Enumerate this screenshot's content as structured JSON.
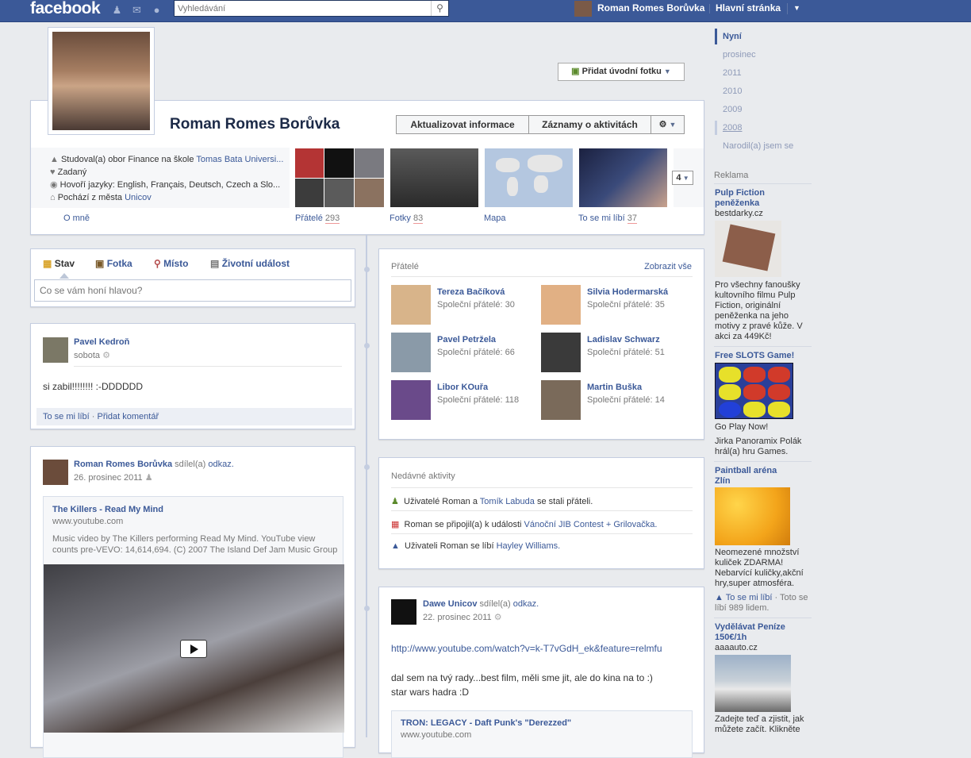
{
  "topbar": {
    "logo": "facebook",
    "search_placeholder": "Vyhledávání",
    "user_name": "Roman Romes Borůvka",
    "home": "Hlavní stránka"
  },
  "cover": {
    "add_cover_label": "Přidat úvodní fotku",
    "name": "Roman Romes Borůvka",
    "update_info": "Aktualizovat informace",
    "activity_log": "Záznamy o aktivitách",
    "about": [
      {
        "prefix": "Studoval(a) obor Finance na škole ",
        "link": "Tomas Bata Universi..."
      },
      {
        "prefix": "Zadaný",
        "link": ""
      },
      {
        "prefix": "Hovoří jazyky: English, Français, Deutsch, Czech a Slo...",
        "link": ""
      },
      {
        "prefix": "Pochází z města ",
        "link": "Unicov"
      }
    ],
    "about_link": "O mně",
    "tiles": [
      {
        "label": "Přátelé",
        "count": "293"
      },
      {
        "label": "Fotky",
        "count": "83"
      },
      {
        "label": "Mapa",
        "count": ""
      },
      {
        "label": "To se mi líbí",
        "count": "37"
      }
    ],
    "more_count": "4"
  },
  "composer": {
    "tabs": [
      "Stav",
      "Fotka",
      "Místo",
      "Životní událost"
    ],
    "placeholder": "Co se vám honí hlavou?"
  },
  "post1": {
    "author": "Pavel Kedroň",
    "time": "sobota",
    "text": "si zabil!!!!!!!! :-DDDDDD",
    "like": "To se mi líbí",
    "dot": "·",
    "comment": "Přidat komentář"
  },
  "post2": {
    "author": "Roman Romes Borůvka",
    "shared": " sdílel(a) ",
    "shared_link": "odkaz.",
    "time": "26. prosinec 2011",
    "link_title": "The Killers - Read My Mind",
    "link_domain": "www.youtube.com",
    "link_desc": "Music video by The Killers performing Read My Mind. YouTube view counts pre-VEVO: 14,614,694. (C) 2007 The Island Def Jam Music Group"
  },
  "friends": {
    "title": "Přátelé",
    "show_all": "Zobrazit vše",
    "list": [
      {
        "name": "Tereza Bačíková",
        "mutual": "Společní přátelé: 30"
      },
      {
        "name": "Silvia Hodermarská",
        "mutual": "Společní přátelé: 35"
      },
      {
        "name": "Pavel Petržela",
        "mutual": "Společní přátelé: 66"
      },
      {
        "name": "Ladislav Schwarz",
        "mutual": "Společní přátelé: 51"
      },
      {
        "name": "Libor KOuřa",
        "mutual": "Společní přátelé: 118"
      },
      {
        "name": "Martin Buška",
        "mutual": "Společní přátelé: 14"
      }
    ]
  },
  "recent": {
    "title": "Nedávné aktivity",
    "items": [
      {
        "a": "Uživatelé Roman a ",
        "link": "Tomík Labuda",
        "b": " se stali přáteli."
      },
      {
        "a": "Roman se připojil(a) k události ",
        "link": "Vánoční JIB Contest + Grilovačka.",
        "b": ""
      },
      {
        "a": "Uživateli Roman se líbí ",
        "link": "Hayley Williams.",
        "b": ""
      }
    ]
  },
  "post3": {
    "author": "Dawe Unicov",
    "shared": " sdílel(a) ",
    "shared_link": "odkaz.",
    "time": "22. prosinec 2011",
    "url": "http://www.youtube.com/watch?v=k-T7vGdH_ek&feature=relmfu",
    "text1": "dal sem na tvý rady...best film, měli sme jit, ale do kina na to :)",
    "text2": "star wars hadra :D",
    "link_title": "TRON: LEGACY - Daft Punk's \"Derezzed\"",
    "link_domain": "www.youtube.com"
  },
  "timeline": [
    "Nyní",
    "prosinec",
    "2011",
    "2010",
    "2009",
    "2008",
    "Narodil(a) jsem se"
  ],
  "ads": {
    "header": "Reklama",
    "items": [
      {
        "title1": "Pulp Fiction",
        "title2": "peněženka",
        "domain": "bestdarky.cz",
        "text": [
          "Pro všechny fanoušky",
          "kultovního filmu Pulp",
          "Fiction, originální",
          "peněženka na jeho",
          "motivy z pravé kůže. V",
          "akci za 449Kč!"
        ]
      },
      {
        "title1": "Free SLOTS Game!",
        "title2": "",
        "domain": "",
        "text": [
          "Go Play Now!"
        ],
        "social": [
          "Jirka Panoramix Polák",
          "hrál(a) hru Games."
        ]
      },
      {
        "title1": "Paintball aréna",
        "title2": "Zlín",
        "domain": "",
        "text": [
          "Neomezené množství",
          "kuliček ZDARMA!",
          "Nebarvící kuličky,akční",
          "hry,super atmosféra."
        ],
        "like": "To se mi líbí",
        "like_rest": " · Toto se",
        "like_line2": "líbí 989 lidem."
      },
      {
        "title1": "Vydělávat Peníze",
        "title2": "150€/1h",
        "domain": "aaaauto.cz",
        "text": [
          "Zadejte teď a zjistit, jak",
          "můžete začít. Klikněte"
        ]
      }
    ]
  }
}
